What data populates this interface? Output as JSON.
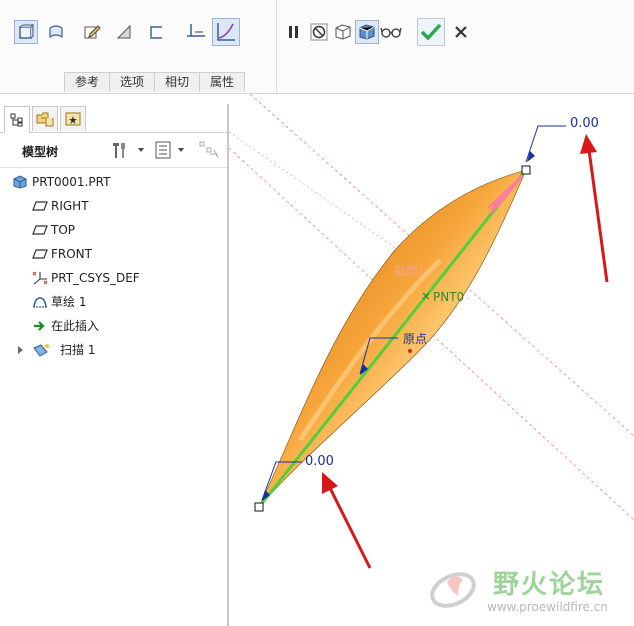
{
  "toolbar": {
    "tabs": [
      "参考",
      "选项",
      "相切",
      "属性"
    ]
  },
  "model_tree": {
    "title": "模型树",
    "items": [
      {
        "label": "PRT0001.PRT",
        "icon": "part-icon"
      },
      {
        "label": "RIGHT",
        "icon": "datum-plane-icon"
      },
      {
        "label": "TOP",
        "icon": "datum-plane-icon"
      },
      {
        "label": "FRONT",
        "icon": "datum-plane-icon"
      },
      {
        "label": "PRT_CSYS_DEF",
        "icon": "csys-icon"
      },
      {
        "label": "草绘 1",
        "icon": "sketch-icon"
      },
      {
        "label": "在此插入",
        "icon": "insert-here-arrow-icon"
      },
      {
        "label": "扫描 1",
        "icon": "sweep-icon"
      }
    ]
  },
  "viewport": {
    "dim_top": "0.00",
    "dim_bottom": "0.00",
    "point_label": "PNT0",
    "origin_label": "原点",
    "section_label": "截面1"
  },
  "watermark": {
    "name": "野火论坛",
    "url": "www.proewildfire.cn"
  },
  "colors": {
    "body": "#e8860f",
    "trajectory": "#4fcf3a",
    "arrow_red": "#d81818",
    "dim_blue": "#1a2fa0",
    "accept_green": "#2aa84a"
  }
}
